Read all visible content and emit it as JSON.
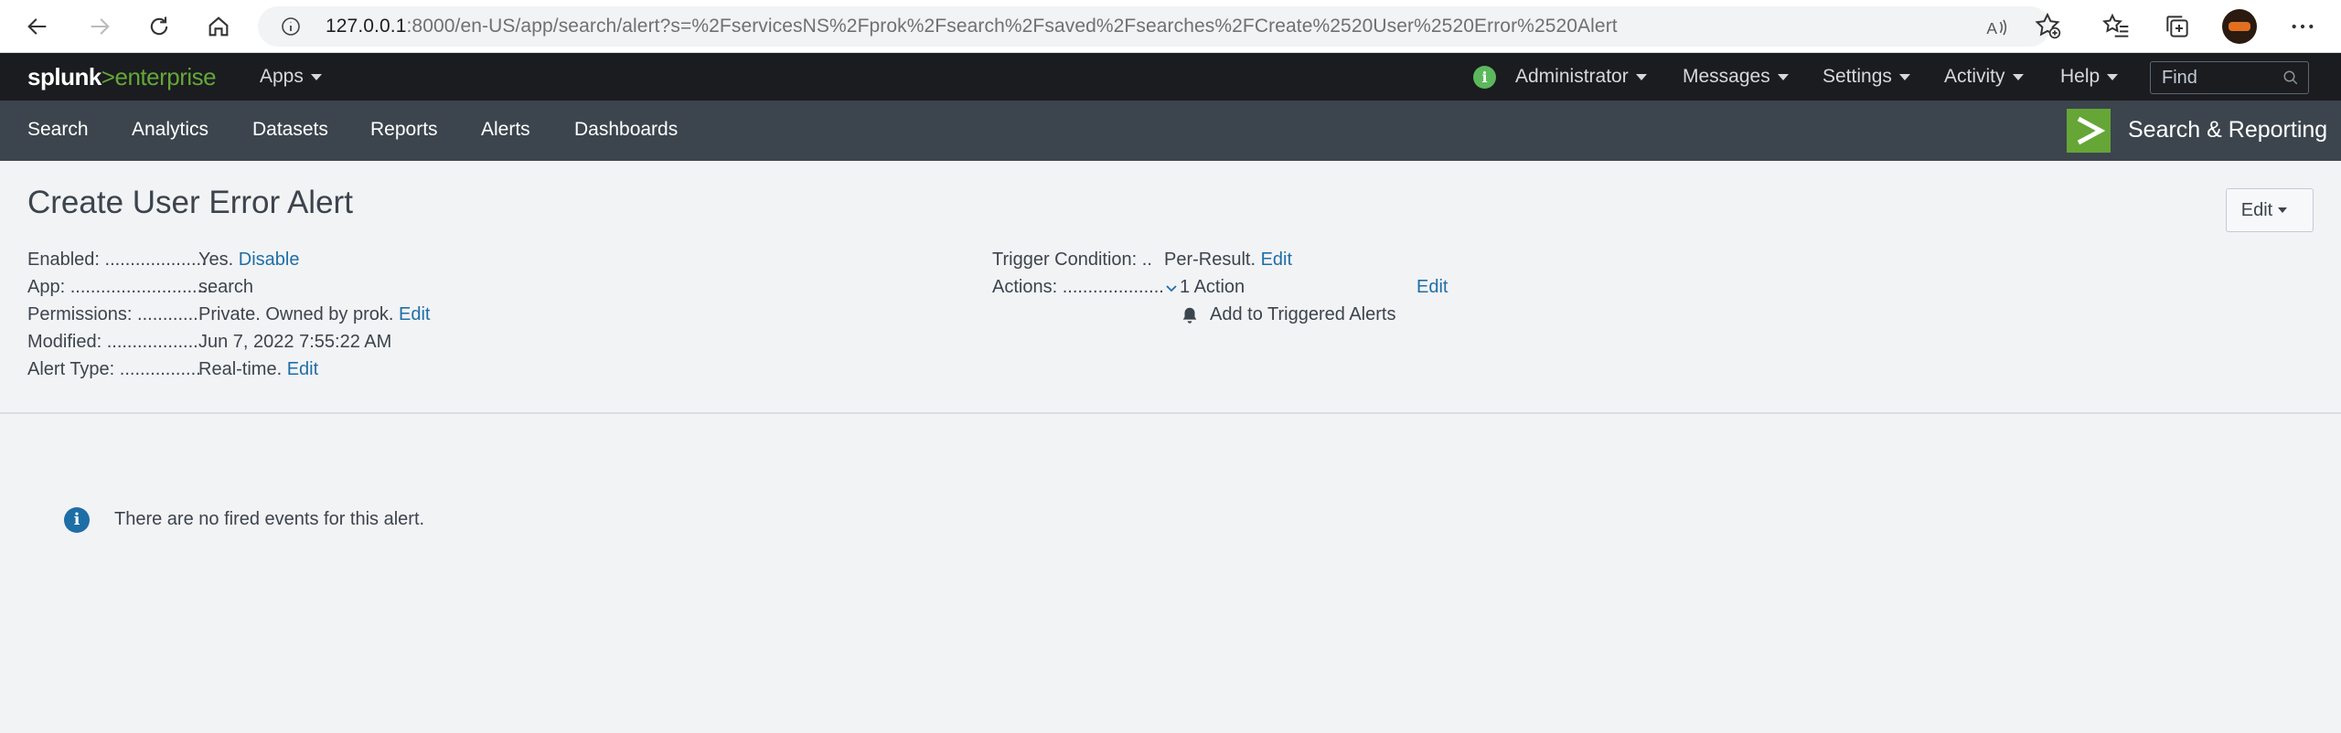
{
  "browser": {
    "url_host": "127.0.0.1",
    "url_rest": ":8000/en-US/app/search/alert?s=%2FservicesNS%2Fprok%2Fsearch%2Fsaved%2Fsearches%2FCreate%2520User%2520Error%2520Alert"
  },
  "topbar": {
    "logo_splunk": "splunk",
    "logo_gt": ">",
    "logo_enterprise": "enterprise",
    "apps_label": "Apps",
    "menus": [
      "Administrator",
      "Messages",
      "Settings",
      "Activity",
      "Help"
    ],
    "find_placeholder": "Find"
  },
  "appbar": {
    "nav": [
      "Search",
      "Analytics",
      "Datasets",
      "Reports",
      "Alerts",
      "Dashboards"
    ],
    "app_title": "Search & Reporting"
  },
  "alert": {
    "title": "Create User Error Alert",
    "edit_button": "Edit",
    "left": {
      "enabled_label": "Enabled: ....................",
      "enabled_value": "Yes.",
      "enabled_link": "Disable",
      "app_label": "App: ............................",
      "app_value": "search",
      "permissions_label": "Permissions: ............",
      "permissions_value": "Private. Owned by prok.",
      "permissions_link": "Edit",
      "modified_label": "Modified: ..................",
      "modified_value": "Jun 7, 2022 7:55:22 AM",
      "alert_type_label": "Alert Type: ................",
      "alert_type_value": "Real-time.",
      "alert_type_link": "Edit"
    },
    "right": {
      "trigger_label": "Trigger Condition: ..",
      "trigger_value": "Per-Result.",
      "trigger_link": "Edit",
      "actions_label": "Actions: ....................",
      "actions_value": "1 Action",
      "actions_link": "Edit",
      "action_item": "Add to Triggered Alerts"
    },
    "notice": "There are no fired events for this alert."
  },
  "colors": {
    "splunk_green": "#65a637",
    "link_blue": "#1e6ea7",
    "topbar_bg": "#1a1c20",
    "appbar_bg": "#3c444d"
  }
}
